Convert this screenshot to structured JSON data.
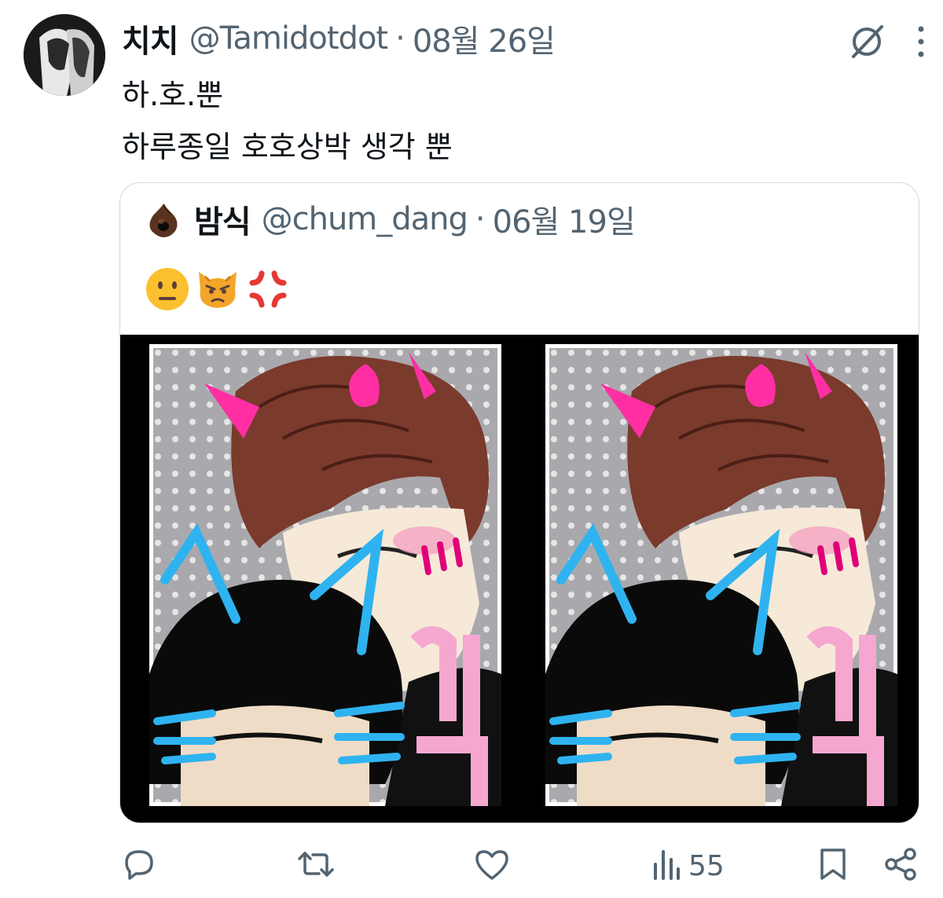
{
  "tweet": {
    "display_name": "치치",
    "handle": "@Tamidotdot",
    "separator": "·",
    "date": "08월 26일",
    "lines": [
      "하.호.뿐",
      "하루종일 호호상박 생각 뿐"
    ]
  },
  "quote": {
    "display_name": "밤식",
    "handle": "@chum_dang",
    "separator": "·",
    "date": "06월 19일",
    "emojis": [
      "neutral-face",
      "pouting-cat",
      "anger-symbol"
    ]
  },
  "actions": {
    "views_count": "55"
  },
  "icons": [
    "grok-icon",
    "more-icon",
    "reply-icon",
    "retweet-icon",
    "like-icon",
    "views-icon",
    "bookmark-icon",
    "share-icon"
  ],
  "colors": {
    "text": "#0f1419",
    "secondary": "#536471",
    "border": "#cfd9de"
  }
}
